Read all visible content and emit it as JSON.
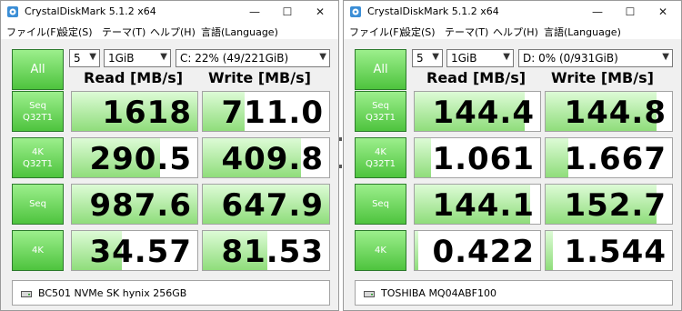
{
  "windows": [
    {
      "title": "CrystalDiskMark 5.1.2 x64",
      "menu": [
        "ファイル(F)",
        "設定(S)",
        "テーマ(T)",
        "ヘルプ(H)",
        "言語(Language)"
      ],
      "all_label": "All",
      "count_select": "5",
      "size_select": "1GiB",
      "drive_select": "C: 22% (49/221GiB)",
      "read_header": "Read [MB/s]",
      "write_header": "Write [MB/s]",
      "rows": [
        {
          "label": [
            "Seq",
            "Q32T1"
          ],
          "read": "1618",
          "write": "711.0",
          "read_fill": 1.0,
          "write_fill": 0.33
        },
        {
          "label": [
            "4K",
            "Q32T1"
          ],
          "read": "290.5",
          "write": "409.8",
          "read_fill": 0.7,
          "write_fill": 0.78
        },
        {
          "label": [
            "Seq"
          ],
          "read": "987.6",
          "write": "647.9",
          "read_fill": 1.0,
          "write_fill": 1.0
        },
        {
          "label": [
            "4K"
          ],
          "read": "34.57",
          "write": "81.53",
          "read_fill": 0.4,
          "write_fill": 0.51
        }
      ],
      "comment": "BC501 NVMe SK hynix 256GB"
    },
    {
      "title": "CrystalDiskMark 5.1.2 x64",
      "menu": [
        "ファイル(F)",
        "設定(S)",
        "テーマ(T)",
        "ヘルプ(H)",
        "言語(Language)"
      ],
      "all_label": "All",
      "count_select": "5",
      "size_select": "1GiB",
      "drive_select": "D: 0% (0/931GiB)",
      "read_header": "Read [MB/s]",
      "write_header": "Write [MB/s]",
      "rows": [
        {
          "label": [
            "Seq",
            "Q32T1"
          ],
          "read": "144.4",
          "write": "144.8",
          "read_fill": 0.88,
          "write_fill": 0.88
        },
        {
          "label": [
            "4K",
            "Q32T1"
          ],
          "read": "1.061",
          "write": "1.667",
          "read_fill": 0.13,
          "write_fill": 0.18
        },
        {
          "label": [
            "Seq"
          ],
          "read": "144.1",
          "write": "152.7",
          "read_fill": 0.92,
          "write_fill": 0.88
        },
        {
          "label": [
            "4K"
          ],
          "read": "0.422",
          "write": "1.544",
          "read_fill": 0.03,
          "write_fill": 0.06
        }
      ],
      "comment": "TOSHIBA MQ04ABF100"
    }
  ],
  "colors": {
    "button_green_top": "#9cef8c",
    "button_green_bottom": "#4ec43e",
    "bar_green_light": "#ddfbd6",
    "bar_green_dark": "#8fdd7b"
  },
  "icons": {
    "app": "crystaldiskmark-app-icon",
    "minimize": "minimize-icon",
    "maximize": "maximize-icon",
    "close": "close-icon",
    "dropdown": "chevron-down-icon",
    "drive": "drive-icon"
  }
}
